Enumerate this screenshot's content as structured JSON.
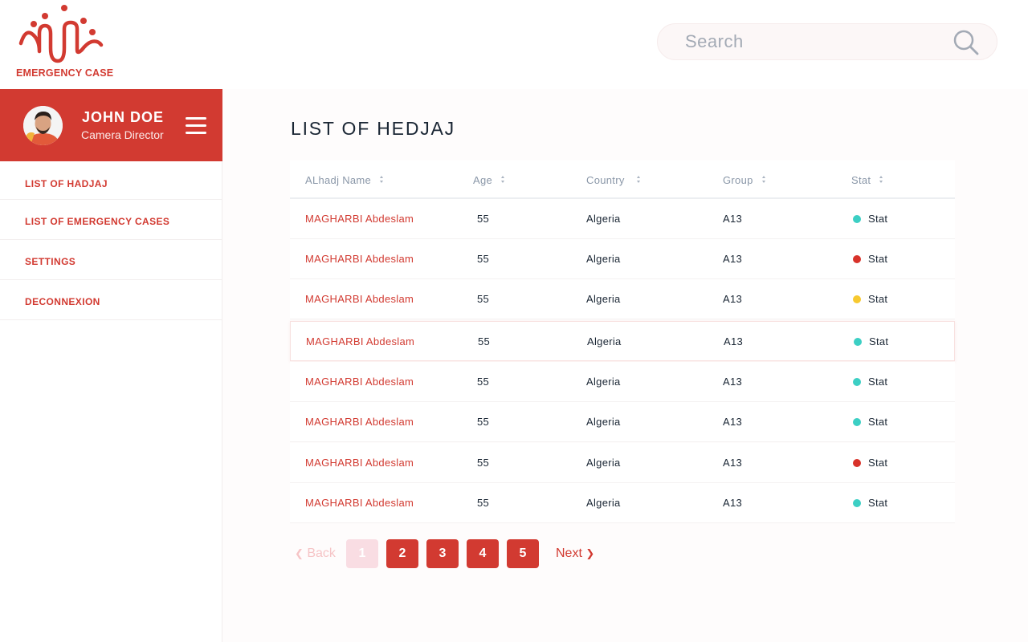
{
  "brand": {
    "name": "EMERGENCY CASE",
    "color": "#d23a31"
  },
  "search": {
    "placeholder": "Search",
    "icon": "search-icon"
  },
  "user": {
    "name": "JOHN DOE",
    "role": "Camera Director",
    "avatar": "avatar-photo",
    "menu_icon": "hamburger-icon"
  },
  "sidebar": {
    "items": [
      {
        "label": "LIST OF HADJAJ"
      },
      {
        "label": "LIST OF EMERGENCY CASES"
      },
      {
        "label": "SETTINGS"
      },
      {
        "label": "DECONNEXION"
      }
    ]
  },
  "page": {
    "title": "LIST OF HEDJAJ"
  },
  "table": {
    "columns": [
      "ALhadj Name",
      "Age",
      "Country",
      "Group",
      "Stat"
    ],
    "status_colors": {
      "teal": "#3ccfc4",
      "red": "#d8322a",
      "yellow": "#f7c930"
    },
    "rows": [
      {
        "name": "MAGHARBI Abdeslam",
        "age": "55",
        "country": "Algeria",
        "group": "A13",
        "stat": "Stat",
        "status": "teal"
      },
      {
        "name": "MAGHARBI Abdeslam",
        "age": "55",
        "country": "Algeria",
        "group": "A13",
        "stat": "Stat",
        "status": "red"
      },
      {
        "name": "MAGHARBI Abdeslam",
        "age": "55",
        "country": "Algeria",
        "group": "A13",
        "stat": "Stat",
        "status": "yellow"
      },
      {
        "name": "MAGHARBI Abdeslam",
        "age": "55",
        "country": "Algeria",
        "group": "A13",
        "stat": "Stat",
        "status": "teal"
      },
      {
        "name": "MAGHARBI Abdeslam",
        "age": "55",
        "country": "Algeria",
        "group": "A13",
        "stat": "Stat",
        "status": "teal"
      },
      {
        "name": "MAGHARBI Abdeslam",
        "age": "55",
        "country": "Algeria",
        "group": "A13",
        "stat": "Stat",
        "status": "teal"
      },
      {
        "name": "MAGHARBI Abdeslam",
        "age": "55",
        "country": "Algeria",
        "group": "A13",
        "stat": "Stat",
        "status": "red"
      },
      {
        "name": "MAGHARBI Abdeslam",
        "age": "55",
        "country": "Algeria",
        "group": "A13",
        "stat": "Stat",
        "status": "teal"
      }
    ]
  },
  "pagination": {
    "back_label": "Back",
    "next_label": "Next",
    "pages": [
      "1",
      "2",
      "3",
      "4",
      "5"
    ],
    "current": "1"
  }
}
